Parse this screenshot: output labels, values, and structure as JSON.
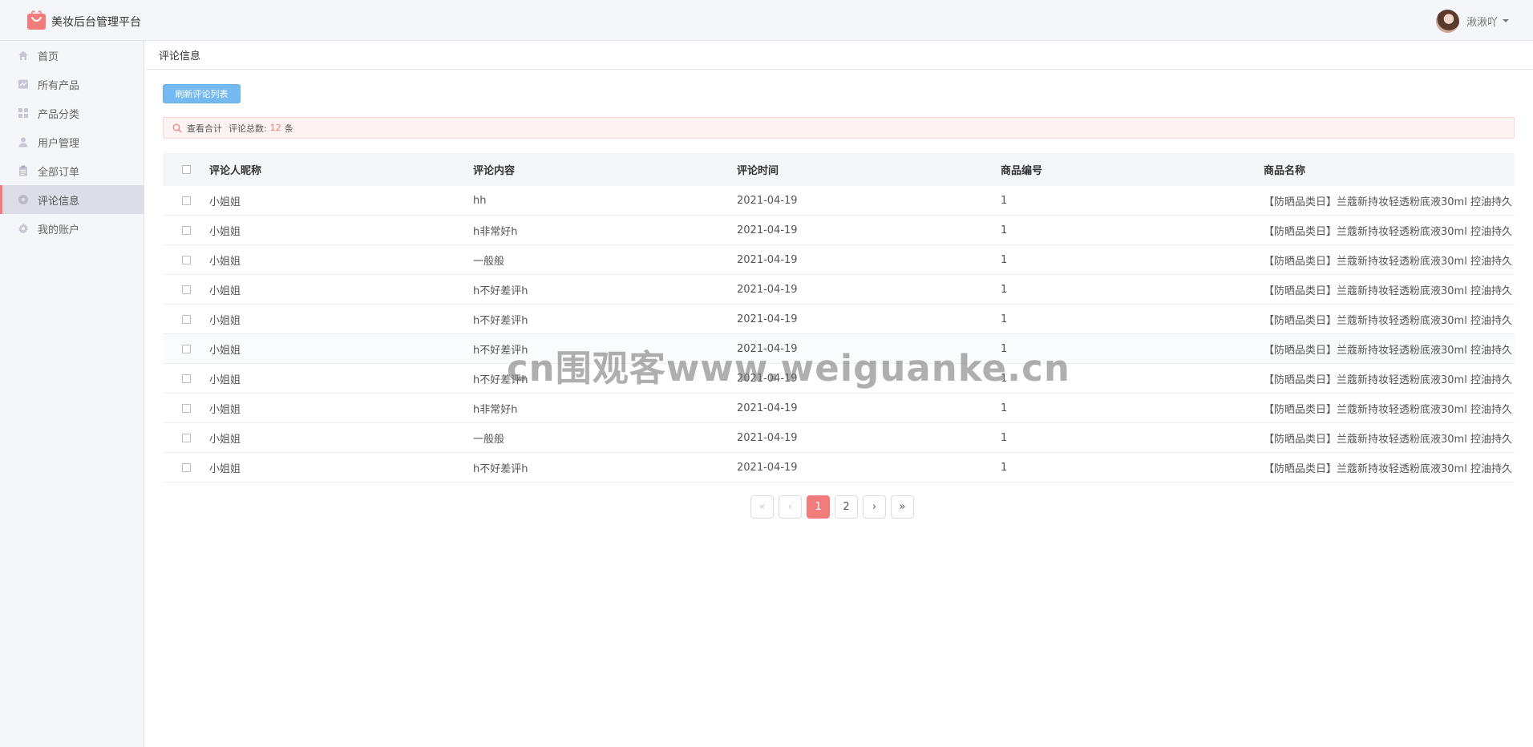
{
  "app": {
    "title": "美妆后台管理平台",
    "accent_color": "#f27b7b",
    "logo_icon": "shopping-bag-icon"
  },
  "user": {
    "name": "湫湫吖"
  },
  "sidebar": {
    "items": [
      {
        "label": "首页",
        "icon": "home-icon"
      },
      {
        "label": "所有产品",
        "icon": "product-icon"
      },
      {
        "label": "产品分类",
        "icon": "grid-icon"
      },
      {
        "label": "用户管理",
        "icon": "user-icon"
      },
      {
        "label": "全部订单",
        "icon": "clipboard-icon"
      },
      {
        "label": "评论信息",
        "icon": "comment-icon",
        "active": true
      },
      {
        "label": "我的账户",
        "icon": "gear-icon"
      }
    ]
  },
  "page": {
    "breadcrumb": "评论信息",
    "refresh_label": "刷新评论列表",
    "summary": {
      "title": "查看合计",
      "total_label": "评论总数:",
      "total_count": "12",
      "unit": "条"
    }
  },
  "table": {
    "columns": [
      "评论人昵称",
      "评论内容",
      "评论时间",
      "商品编号",
      "商品名称"
    ],
    "rows": [
      [
        "小姐姐",
        "hh",
        "2021-04-19",
        "1",
        "【防晒品类日】兰蔻新持妆轻透粉底液30ml 控油持久"
      ],
      [
        "小姐姐",
        "h非常好h",
        "2021-04-19",
        "1",
        "【防晒品类日】兰蔻新持妆轻透粉底液30ml 控油持久"
      ],
      [
        "小姐姐",
        "一般般",
        "2021-04-19",
        "1",
        "【防晒品类日】兰蔻新持妆轻透粉底液30ml 控油持久"
      ],
      [
        "小姐姐",
        "h不好差评h",
        "2021-04-19",
        "1",
        "【防晒品类日】兰蔻新持妆轻透粉底液30ml 控油持久"
      ],
      [
        "小姐姐",
        "h不好差评h",
        "2021-04-19",
        "1",
        "【防晒品类日】兰蔻新持妆轻透粉底液30ml 控油持久"
      ],
      [
        "小姐姐",
        "h不好差评h",
        "2021-04-19",
        "1",
        "【防晒品类日】兰蔻新持妆轻透粉底液30ml 控油持久"
      ],
      [
        "小姐姐",
        "h不好差评h",
        "2021-04-19",
        "1",
        "【防晒品类日】兰蔻新持妆轻透粉底液30ml 控油持久"
      ],
      [
        "小姐姐",
        "h非常好h",
        "2021-04-19",
        "1",
        "【防晒品类日】兰蔻新持妆轻透粉底液30ml 控油持久"
      ],
      [
        "小姐姐",
        "一般般",
        "2021-04-19",
        "1",
        "【防晒品类日】兰蔻新持妆轻透粉底液30ml 控油持久"
      ],
      [
        "小姐姐",
        "h不好差评h",
        "2021-04-19",
        "1",
        "【防晒品类日】兰蔻新持妆轻透粉底液30ml 控油持久"
      ]
    ]
  },
  "pagination": {
    "first": "«",
    "prev": "‹",
    "pages": [
      "1",
      "2"
    ],
    "current": "1",
    "next": "›",
    "last": "»"
  },
  "watermark": "cn围观客www.weiguanke.cn"
}
